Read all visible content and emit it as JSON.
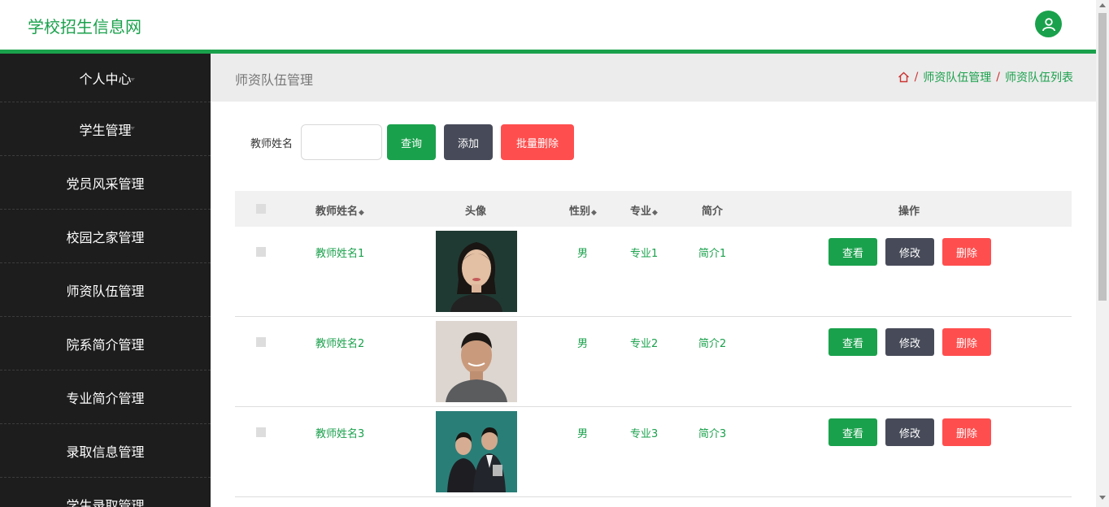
{
  "header": {
    "site_title": "学校招生信息网",
    "avatar_icon": "user-icon"
  },
  "sidebar": {
    "items": [
      {
        "label": "个人中心"
      },
      {
        "label": "学生管理"
      },
      {
        "label": "党员风采管理"
      },
      {
        "label": "校园之家管理"
      },
      {
        "label": "师资队伍管理"
      },
      {
        "label": "院系简介管理"
      },
      {
        "label": "专业简介管理"
      },
      {
        "label": "录取信息管理"
      },
      {
        "label": "学生录取管理"
      }
    ]
  },
  "main": {
    "page_title": "师资队伍管理",
    "breadcrumb": {
      "home_icon": "home-icon",
      "level1": "师资队伍管理",
      "level2": "师资队伍列表",
      "sep": "/"
    },
    "search": {
      "label": "教师姓名",
      "value": "",
      "query_button": "查询",
      "add_button": "添加",
      "batch_delete_button": "批量删除"
    },
    "table": {
      "headers": {
        "name": "教师姓名",
        "photo": "头像",
        "gender": "性别",
        "major": "专业",
        "intro": "简介",
        "actions": "操作"
      },
      "sort_icon": "◆",
      "rows": [
        {
          "name": "教师姓名1",
          "gender": "男",
          "major": "专业1",
          "intro": "简介1"
        },
        {
          "name": "教师姓名2",
          "gender": "男",
          "major": "专业2",
          "intro": "简介2"
        },
        {
          "name": "教师姓名3",
          "gender": "男",
          "major": "专业3",
          "intro": "简介3"
        }
      ],
      "actions": {
        "view": "查看",
        "edit": "修改",
        "delete": "删除"
      }
    }
  },
  "colors": {
    "accent": "#1aa14c",
    "dark": "#474b59",
    "danger": "#ff4e4e",
    "sidebar": "#1d1d1d"
  }
}
